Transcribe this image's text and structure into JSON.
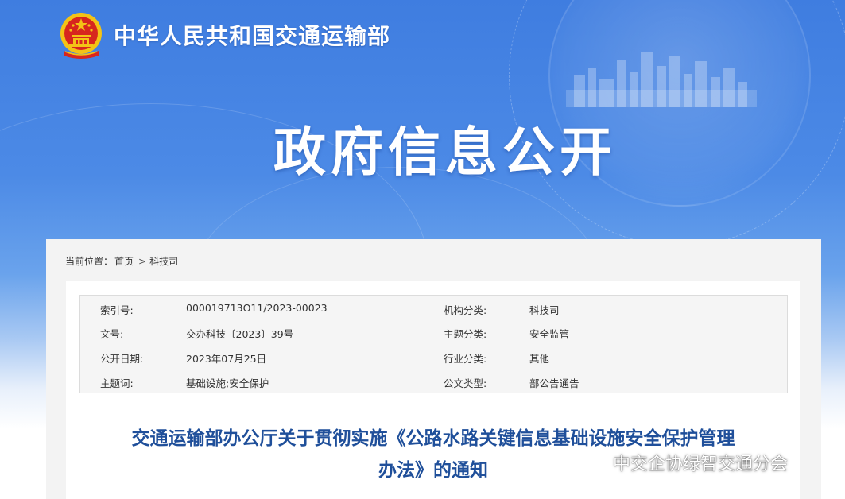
{
  "header": {
    "ministry_name": "中华人民共和国交通运输部",
    "section_title": "政府信息公开"
  },
  "breadcrumb": {
    "label": "当前位置：",
    "items": [
      "首页",
      "科技司"
    ],
    "separator": ">"
  },
  "meta": {
    "rows": [
      {
        "k1": "索引号:",
        "v1": "000019713O11/2023-00023",
        "k2": "机构分类:",
        "v2": "科技司"
      },
      {
        "k1": "文号:",
        "v1": "交办科技〔2023〕39号",
        "k2": "主题分类:",
        "v2": "安全监管"
      },
      {
        "k1": "公开日期:",
        "v1": "2023年07月25日",
        "k2": "行业分类:",
        "v2": "其他"
      },
      {
        "k1": "主题词:",
        "v1": "基础设施;安全保护",
        "k2": "公文类型:",
        "v2": "部公告通告"
      }
    ]
  },
  "document": {
    "title_line1": "交通运输部办公厅关于贯彻实施《公路水路关键信息基础设施安全保护管理",
    "title_line2": "办法》的通知"
  },
  "watermark": {
    "text": "中交企协绿智交通分会",
    "icon": "wechat-icon"
  },
  "colors": {
    "banner_blue": "#3f7de0",
    "title_blue": "#1f4f9a",
    "emblem_red": "#d7261e",
    "emblem_gold": "#f3c316"
  }
}
